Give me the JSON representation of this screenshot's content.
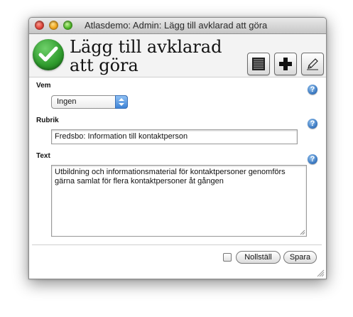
{
  "window": {
    "title": "Atlasdemo: Admin: Lägg till avklarad att göra"
  },
  "header": {
    "title": "Lägg till avklarad att göra",
    "icons": {
      "status": "checkmark-icon",
      "list": "list-icon",
      "add": "plus-icon",
      "edit": "pencil-icon"
    }
  },
  "form": {
    "vem": {
      "label": "Vem",
      "selected": "Ingen"
    },
    "rubrik": {
      "label": "Rubrik",
      "value": "Fredsbo: Information till kontaktperson"
    },
    "text": {
      "label": "Text",
      "value": "Utbildning och informationsmaterial för kontaktpersoner genomförs gärna samlat för flera kontaktpersoner åt gången"
    },
    "help_icon": "help-icon",
    "help_glyph": "?"
  },
  "actions": {
    "reset_label": "Nollställ",
    "save_label": "Spara"
  },
  "colors": {
    "check": "#2e9a2c",
    "help": "#3f7dc4",
    "select_arrows": "#3e83d6"
  }
}
